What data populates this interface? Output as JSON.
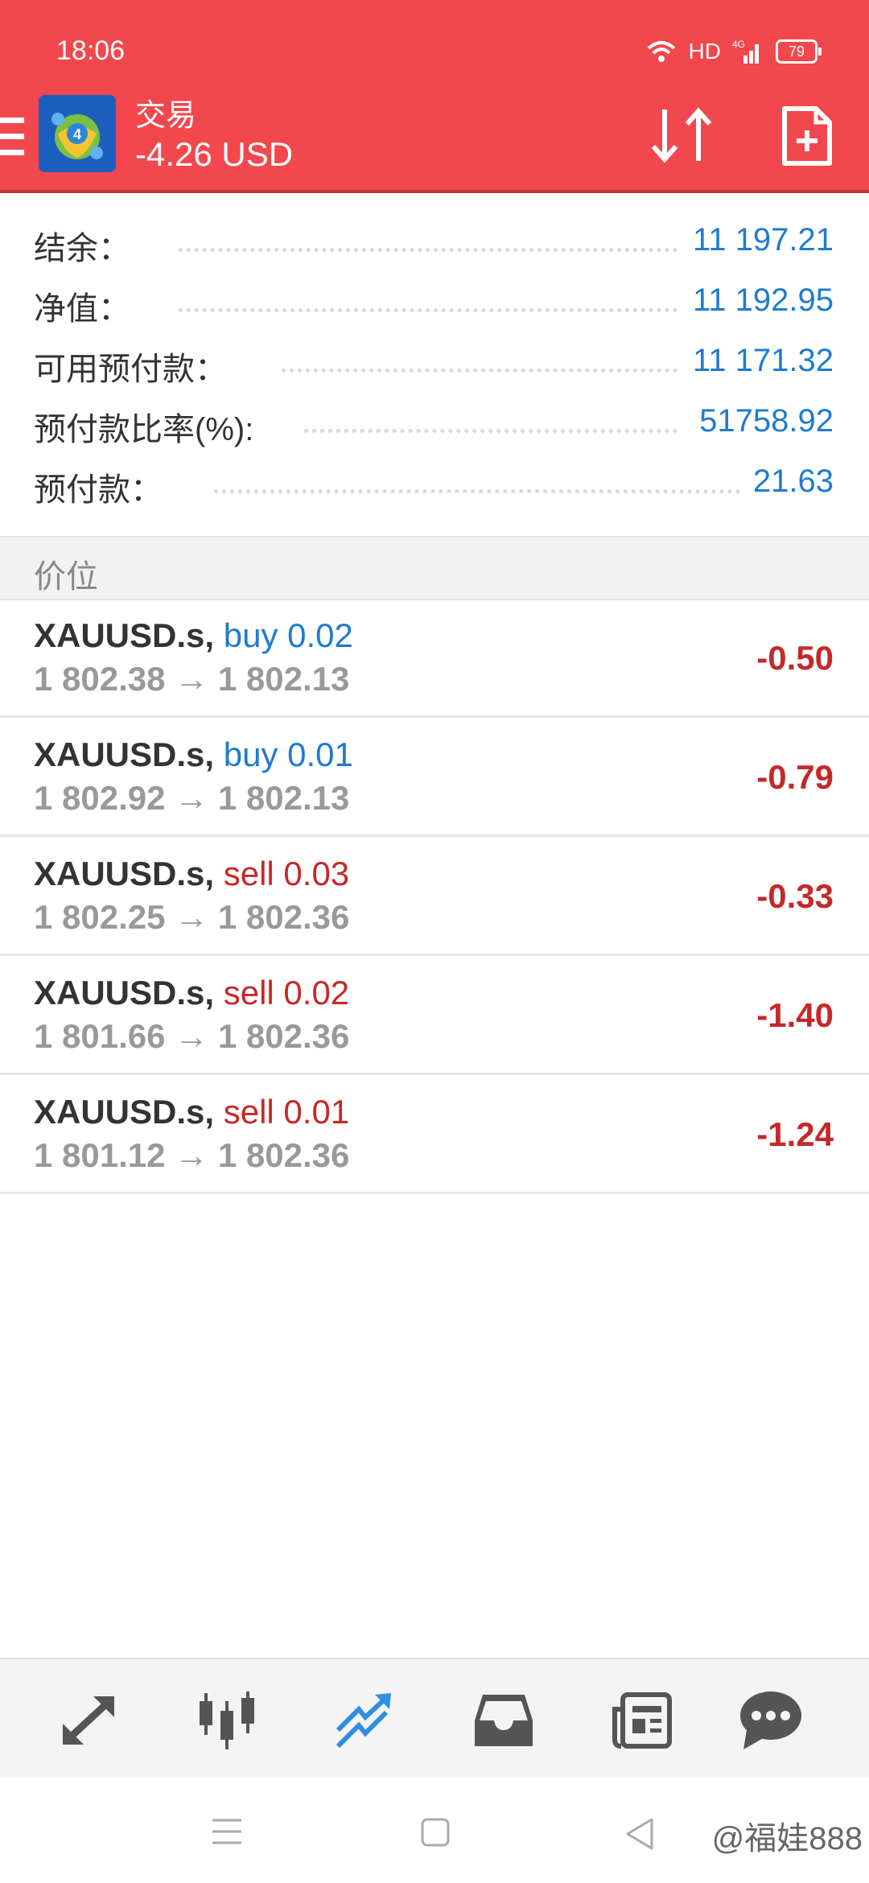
{
  "status_bar": {
    "time": "18:06",
    "network": "HD",
    "battery": "79"
  },
  "header": {
    "title": "交易",
    "profit": "-4.26 USD",
    "background_color": "#f2474d",
    "icons": [
      "menu-icon",
      "app-logo",
      "sort-icon",
      "new-order-icon"
    ]
  },
  "summary": [
    {
      "label": "结余：",
      "value": "11 197.21"
    },
    {
      "label": "净值：",
      "value": "11 192.95"
    },
    {
      "label": "可用预付款：",
      "value": "11 171.32"
    },
    {
      "label": "预付款比率(%):",
      "value": "51758.92"
    },
    {
      "label": "预付款：",
      "value": "21.63"
    }
  ],
  "positions_section": {
    "title": "价位"
  },
  "positions": [
    {
      "symbol": "XAUUSD.s,",
      "type": "buy 0.02",
      "open": "1 802.38",
      "arrow": "→",
      "current": "1 802.13",
      "profit": "-0.50"
    },
    {
      "symbol": "XAUUSD.s,",
      "type": "buy 0.01",
      "open": "1 802.92",
      "arrow": "→",
      "current": "1 802.13",
      "profit": "-0.79"
    },
    {
      "symbol": "XAUUSD.s,",
      "type": "sell 0.03",
      "open": "1 802.25",
      "arrow": "→",
      "current": "1 802.36",
      "profit": "-0.33"
    },
    {
      "symbol": "XAUUSD.s,",
      "type": "sell 0.02",
      "open": "1 801.66",
      "arrow": "→",
      "current": "1 802.36",
      "profit": "-1.40"
    },
    {
      "symbol": "XAUUSD.s,",
      "type": "sell 0.01",
      "open": "1 801.12",
      "arrow": "→",
      "current": "1 802.36",
      "profit": "-1.24"
    }
  ],
  "bottom_nav": {
    "items": [
      "quotes-icon",
      "chart-icon",
      "trade-icon",
      "history-icon",
      "news-icon",
      "chat-icon"
    ],
    "active": "trade-icon",
    "active_color": "#2f8fe0"
  },
  "colors": {
    "value_blue": "#1f7bd0",
    "loss_red": "#c62828"
  },
  "watermark": "@福娃888"
}
